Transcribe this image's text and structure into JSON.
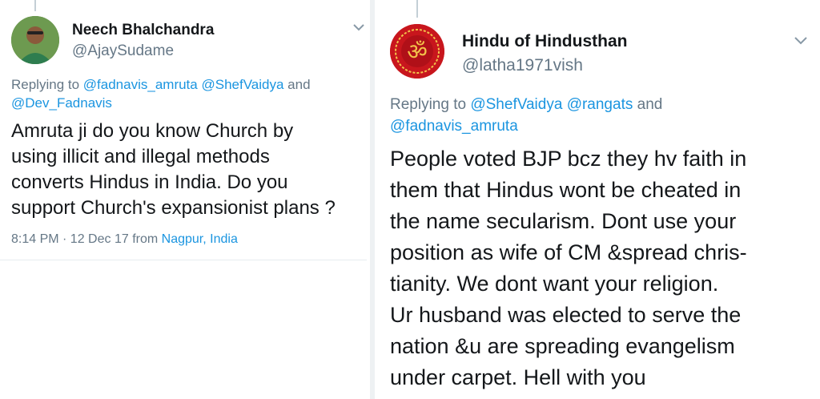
{
  "left_tweet": {
    "author_name": "Neech Bhalchandra",
    "author_handle": "@AjaySudame",
    "replying_prefix": "Replying to",
    "replying_mentions": [
      "@fadnavis_amruta",
      "@ShefVaidya"
    ],
    "replying_and": "and",
    "replying_mention_last": "@Dev_Fadnavis",
    "body_lines": [
      "Amruta ji do you know Church by",
      "using illicit and illegal methods",
      "converts Hindus in India. Do you",
      "support Church's expansionist plans ?"
    ],
    "time": "8:14 PM · 12 Dec 17",
    "from_label": "from",
    "location": "Nagpur, India"
  },
  "right_tweet": {
    "author_name": "Hindu of Hindusthan",
    "author_handle": "@latha1971vish",
    "replying_prefix": "Replying to",
    "replying_mentions": [
      "@ShefVaidya",
      "@rangats"
    ],
    "replying_and": "and",
    "replying_mention_last": "@fadnavis_amruta",
    "body_lines": [
      "People voted BJP bcz they hv faith in",
      "them that Hindus wont be cheated in",
      "the name secularism. Dont use your",
      "position as wife of CM &spread chris-",
      "tianity. We dont want your religion.",
      "Ur husband was elected to serve the",
      "nation &u are spreading evangelism",
      "under carpet. Hell with you"
    ]
  },
  "icons": {
    "chevron": "chevron-down-icon",
    "om_symbol": "ॐ"
  },
  "colors": {
    "link": "#1b95e0",
    "muted": "#657786",
    "om_red": "#c8161d",
    "om_gold": "#f3c24a"
  }
}
